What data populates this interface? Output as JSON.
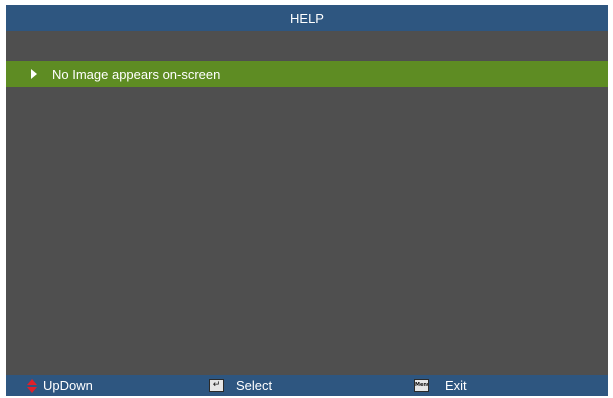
{
  "header": {
    "title": "HELP"
  },
  "menu": {
    "items": [
      {
        "label": "No Image appears on-screen",
        "selected": true
      }
    ]
  },
  "footer": {
    "hints": [
      {
        "label": "UpDown",
        "icon": "up-down-arrows-icon"
      },
      {
        "label": "Select",
        "icon": "enter-key-icon"
      },
      {
        "label": "Exit",
        "icon": "menu-key-icon",
        "icon_text": "Menu"
      }
    ]
  },
  "colors": {
    "title_bar": "#2e5680",
    "panel": "#4f4f4f",
    "selection": "#5e8c23",
    "footer_bar": "#2e5680",
    "updown_icon": "#e0202a",
    "text": "#ffffff"
  }
}
